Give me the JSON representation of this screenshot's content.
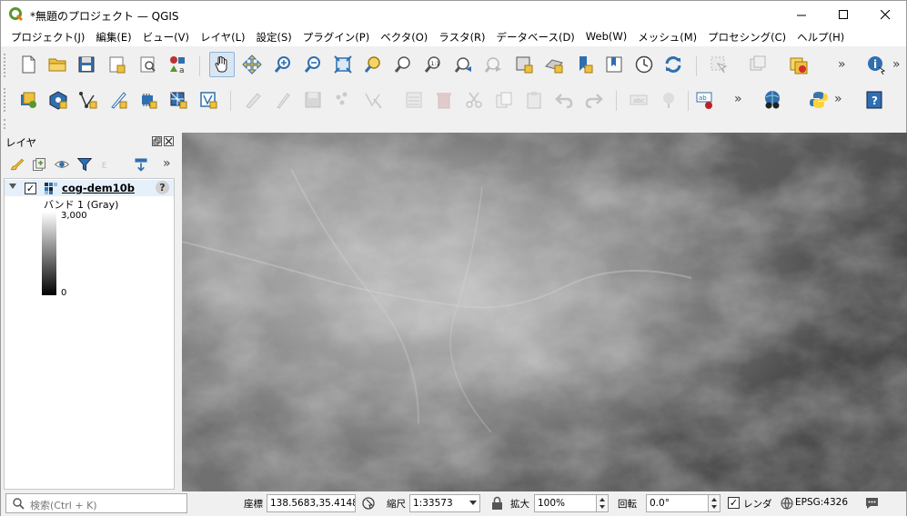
{
  "window": {
    "title": "*無題のプロジェクト — QGIS",
    "minimize_glyph": "—",
    "maximize_glyph": "☐",
    "close_glyph": "✕"
  },
  "menu": [
    "プロジェクト(J)",
    "編集(E)",
    "ビュー(V)",
    "レイヤ(L)",
    "設定(S)",
    "プラグイン(P)",
    "ベクタ(O)",
    "ラスタ(R)",
    "データベース(D)",
    "Web(W)",
    "メッシュ(M)",
    "プロセシング(C)",
    "ヘルプ(H)"
  ],
  "toolbar_overflow": "»",
  "layers_panel": {
    "title": "レイヤ",
    "layer_name": "cog-dem10b",
    "band_label": "バンド 1 (Gray)",
    "legend_max": "3,000",
    "legend_min": "0",
    "checked": "✓",
    "help": "?"
  },
  "statusbar": {
    "search_placeholder": "検索(Ctrl + K)",
    "coord_label": "座標",
    "coord_value": "138.5683,35.4148",
    "scale_label": "縮尺",
    "scale_value": "1:33573",
    "magnifier_label": "拡大",
    "magnifier_value": "100%",
    "rotation_label": "回転",
    "rotation_value": "0.0°",
    "render_label": "レンダ",
    "render_checked": "✓",
    "crs_value": "EPSG:4326"
  },
  "colors": {
    "accent": "#2f6fb0",
    "qgis_green": "#589632",
    "map_dark": "#4e4e4e",
    "map_light": "#c8c8c8"
  },
  "icons": [
    "new-project-icon",
    "open-icon",
    "save-icon",
    "pan-icon",
    "zoom-in-icon",
    "zoom-out-icon",
    "refresh-icon",
    "python-icon",
    "help-icon"
  ]
}
